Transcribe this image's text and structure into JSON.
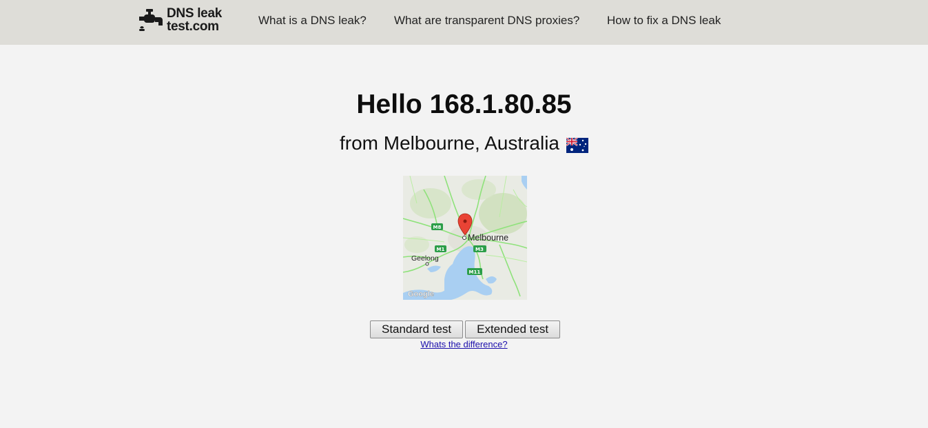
{
  "header": {
    "logo": {
      "line1": "DNS leak",
      "line2": "test.com"
    },
    "nav": [
      {
        "label": "What is a DNS leak?"
      },
      {
        "label": "What are transparent DNS proxies?"
      },
      {
        "label": "How to fix a DNS leak"
      }
    ]
  },
  "main": {
    "greeting": "Hello 168.1.80.85",
    "location": "from Melbourne, Australia",
    "flag_icon": "australia-flag-icon",
    "map": {
      "labels": {
        "city": "Melbourne",
        "geelong": "Geelong",
        "m8": "M8",
        "m1": "M1",
        "m3": "M3",
        "m11": "M11",
        "attribution": "Google"
      }
    },
    "buttons": {
      "standard": "Standard test",
      "extended": "Extended test"
    },
    "difference_link": "Whats the difference?"
  },
  "colors": {
    "header_bg": "#deddd8",
    "page_bg": "#f3f3f3",
    "link": "#1a0dab",
    "map_water": "#a9cff2",
    "map_road": "#8ee27a",
    "marker": "#e94335"
  }
}
